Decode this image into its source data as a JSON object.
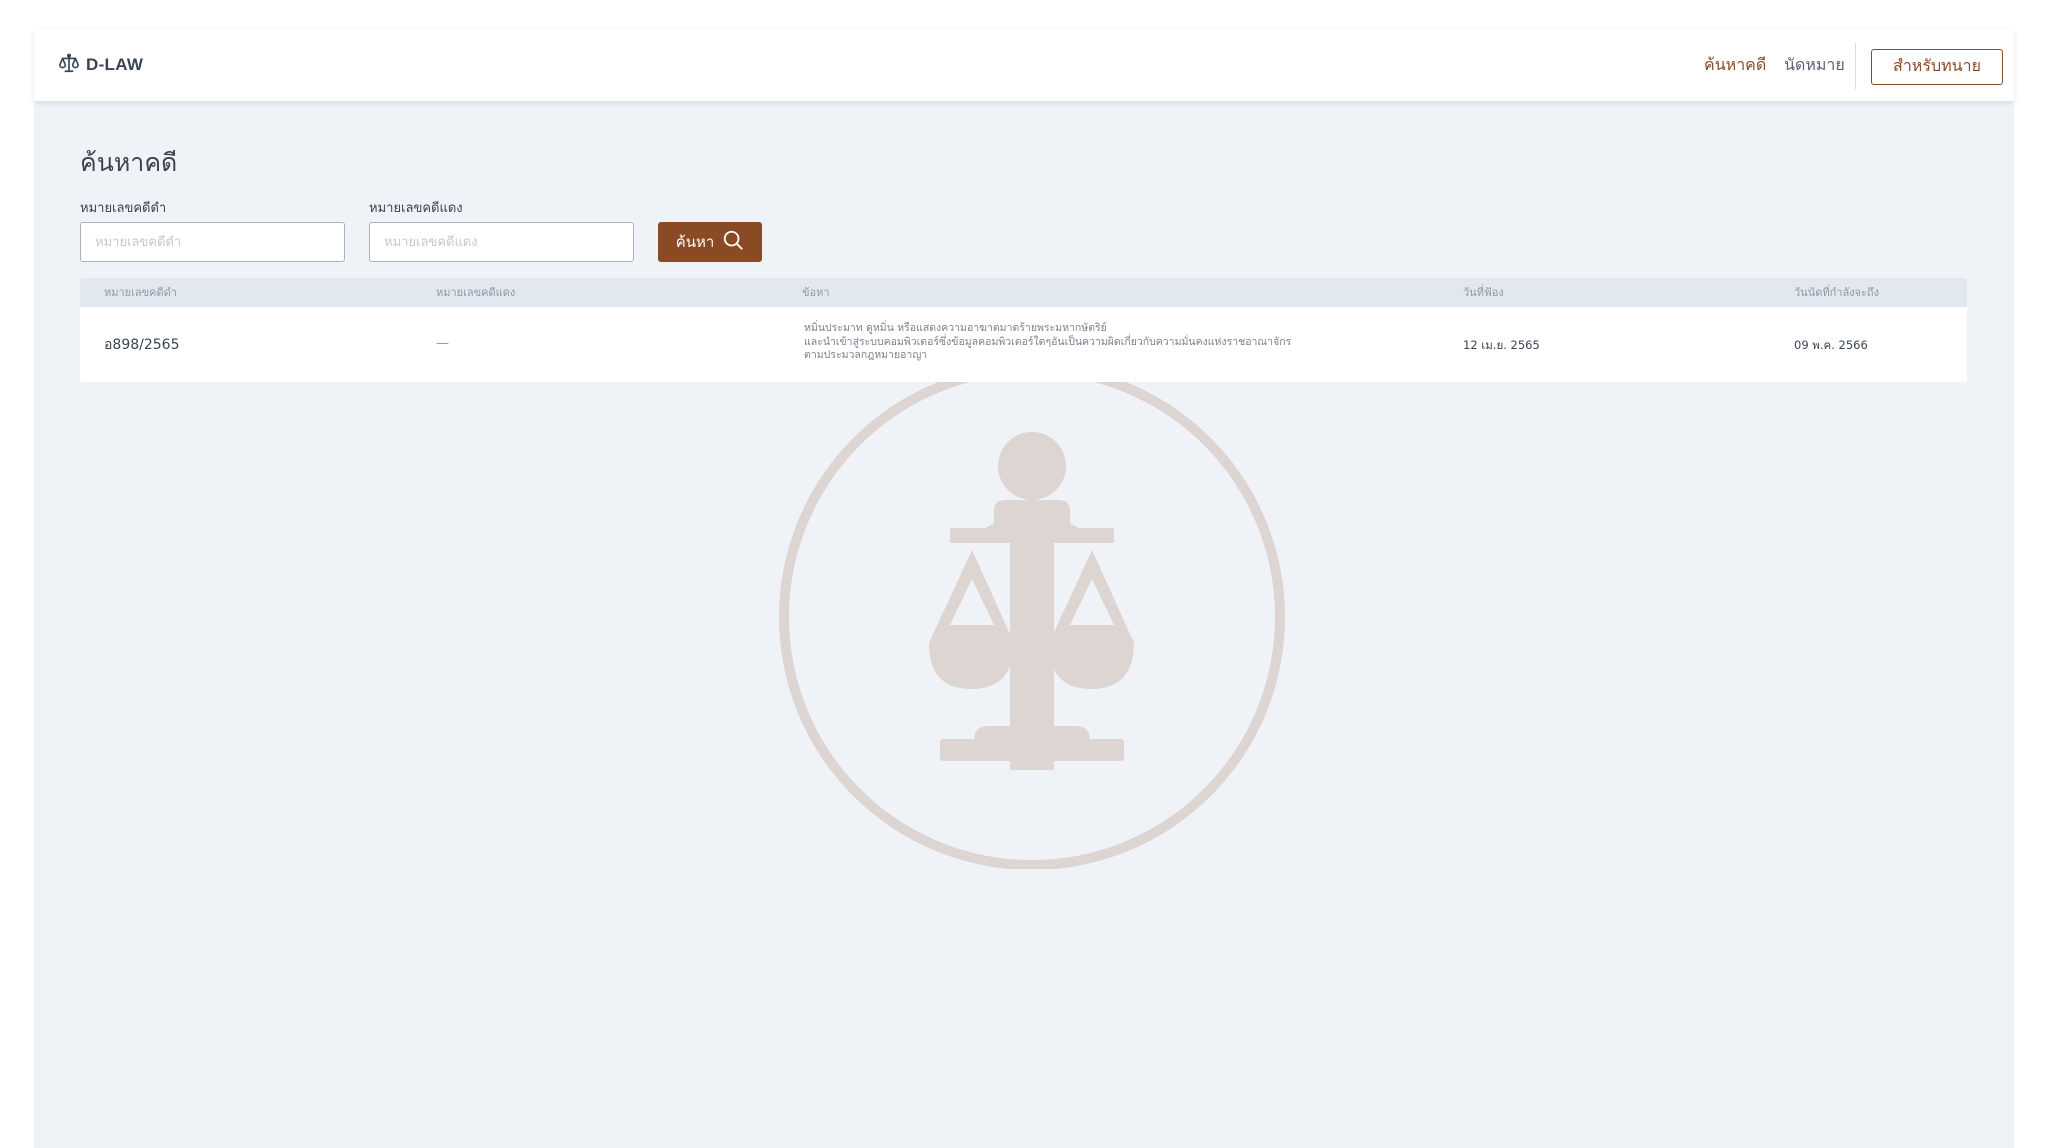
{
  "header": {
    "brand": "D-LAW",
    "brand_icon": "scales-icon",
    "nav": {
      "search_cases": "ค้นหาคดี",
      "appointments": "นัดหมาย"
    },
    "lawyer_button": "สำหรับทนาย"
  },
  "page": {
    "title": "ค้นหาคดี"
  },
  "search": {
    "black_case_label": "หมายเลขคดีดำ",
    "black_case_placeholder": "หมายเลขคดีดำ",
    "red_case_label": "หมายเลขคดีแดง",
    "red_case_placeholder": "หมายเลขคดีแดง",
    "button_label": "ค้นหา",
    "button_icon": "search-icon"
  },
  "table": {
    "columns": [
      "หมายเลขคดีดำ",
      "หมายเลขคดีแดง",
      "ข้อหา",
      "วันที่ฟ้อง",
      "วันนัดที่กำลังจะถึง"
    ],
    "rows": [
      {
        "black_case": "อ898/2565",
        "red_case": "—",
        "charge_lines": [
          "หมิ่นประมาท ดูหมิ่น หรือแสดงความอาฆาตมาดร้ายพระมหากษัตริย์",
          "และนำเข้าสู่ระบบคอมพิวเตอร์ซึ่งข้อมูลคอมพิวเตอร์ใดๆอันเป็นความผิดเกี่ยวกับความมั่นคงแห่งราชอาณาจักร",
          "ตามประมวลกฎหมายอาญา"
        ],
        "filed_date": "12 เม.ย. 2565",
        "next_appointment": "09 พ.ค. 2566"
      }
    ]
  },
  "watermark": {
    "icon": "scales-of-justice-icon"
  },
  "colors": {
    "accent": "#8a4a24",
    "background": "#eff3f8",
    "table_header": "#e2e8ef",
    "text": "#3a4452",
    "watermark": "#dcd5d1"
  }
}
